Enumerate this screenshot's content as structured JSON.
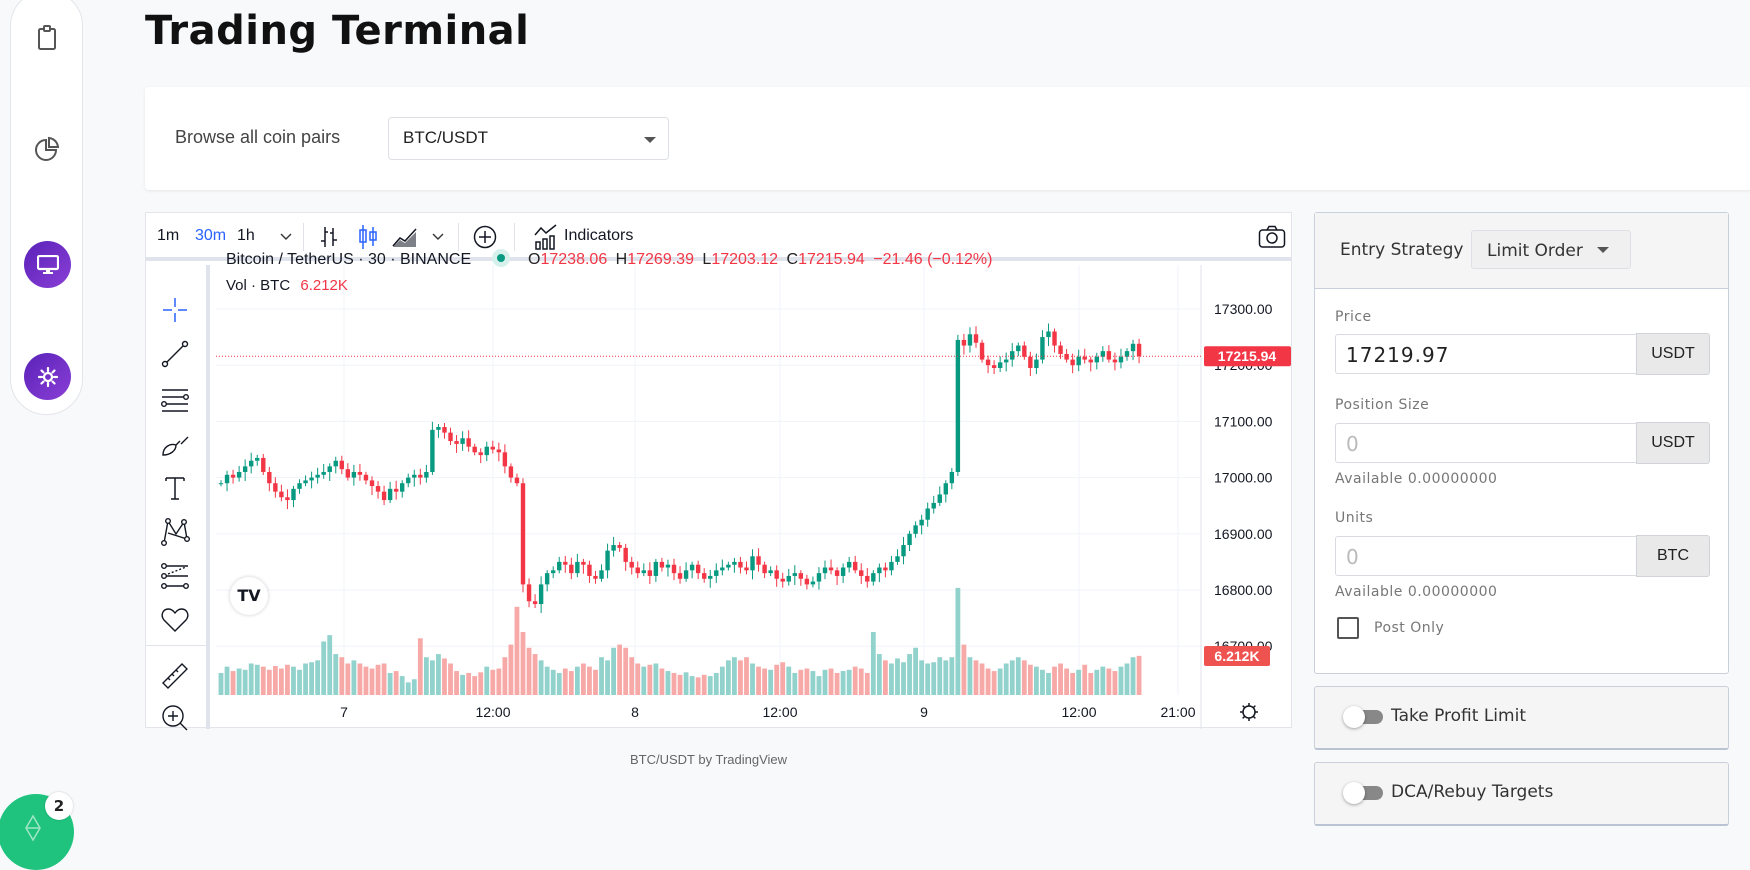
{
  "sidebar": {
    "items": [
      {
        "icon": "clipboard-icon"
      },
      {
        "icon": "pie-chart-icon"
      },
      {
        "icon": "monitor-icon",
        "active": true
      },
      {
        "icon": "gear-icon",
        "active": true
      }
    ],
    "notification": {
      "icon": "rocket-icon",
      "count": "2",
      "color": "#1fc37e"
    }
  },
  "header": {
    "title": "Trading Terminal"
  },
  "pair_selector": {
    "label": "Browse all coin pairs",
    "value": "BTC/USDT"
  },
  "chart_toolbar": {
    "intervals": [
      "1m",
      "30m",
      "1h"
    ],
    "active_interval": "30m",
    "indicators_label": "Indicators"
  },
  "chart_legend": {
    "symbol": "Bitcoin / TetherUS · 30 · BINANCE",
    "o_label": "O",
    "o": "17238.06",
    "h_label": "H",
    "h": "17269.39",
    "l_label": "L",
    "l": "17203.12",
    "c_label": "C",
    "c": "17215.94",
    "change": "−21.46 (−0.12%)",
    "vol_label": "Vol · BTC",
    "vol": "6.212K"
  },
  "chart_data": {
    "type": "candlestick",
    "interval": "30m",
    "yaxis_ticks": [
      "17300.00",
      "17200.00",
      "17100.00",
      "17000.00",
      "16900.00",
      "16800.00",
      "16700.00"
    ],
    "ylim": [
      16700,
      17300
    ],
    "xaxis_ticks": [
      "7",
      "12:00",
      "8",
      "12:00",
      "9",
      "12:00",
      "21:00"
    ],
    "last_price_label": "17215.94",
    "last_volume_label": "6.212K",
    "grid": true,
    "up_color": "#089981",
    "down_color": "#f23645",
    "closes": [
      16990,
      17005,
      17000,
      17010,
      17020,
      17030,
      17035,
      17010,
      16990,
      16975,
      16965,
      16960,
      16980,
      16990,
      16995,
      17000,
      17005,
      17010,
      17020,
      17030,
      17015,
      17000,
      17010,
      17005,
      16995,
      16985,
      16975,
      16960,
      16980,
      16975,
      16990,
      17000,
      17005,
      17000,
      17010,
      17085,
      17090,
      17080,
      17065,
      17060,
      17070,
      17055,
      17045,
      17040,
      17055,
      17050,
      17045,
      17020,
      17000,
      16990,
      16810,
      16780,
      16775,
      16810,
      16830,
      16835,
      16850,
      16845,
      16830,
      16850,
      16845,
      16825,
      16820,
      16835,
      16870,
      16880,
      16875,
      16850,
      16840,
      16830,
      16835,
      16825,
      16850,
      16840,
      16845,
      16830,
      16820,
      16835,
      16845,
      16830,
      16820,
      16825,
      16835,
      16840,
      16845,
      16850,
      16840,
      16835,
      16860,
      16845,
      16830,
      16835,
      16820,
      16815,
      16825,
      16830,
      16820,
      16810,
      16815,
      16830,
      16840,
      16835,
      16825,
      16840,
      16850,
      16835,
      16825,
      16815,
      16830,
      16840,
      16835,
      16850,
      16860,
      16880,
      16900,
      16915,
      16925,
      16945,
      16955,
      16970,
      16990,
      17010,
      17245,
      17235,
      17255,
      17240,
      17210,
      17200,
      17195,
      17205,
      17210,
      17225,
      17235,
      17215,
      17195,
      17210,
      17250,
      17260,
      17235,
      17220,
      17210,
      17200,
      17215,
      17210,
      17205,
      17215,
      17225,
      17210,
      17205,
      17215,
      17225,
      17238.06,
      17215.94
    ],
    "volumes_k": [
      3.5,
      4.5,
      3.8,
      4.2,
      4.0,
      5.0,
      4.8,
      4.5,
      4.0,
      4.6,
      4.2,
      4.8,
      4.5,
      4.0,
      5.0,
      5.2,
      5.5,
      8.5,
      9.5,
      6.5,
      6.0,
      5.0,
      5.5,
      5.0,
      4.5,
      4.2,
      4.8,
      5.0,
      3.5,
      3.8,
      3.0,
      2.0,
      2.5,
      9.0,
      6.0,
      5.5,
      6.5,
      5.8,
      5.0,
      3.8,
      3.2,
      3.5,
      3.0,
      3.6,
      4.5,
      4.0,
      4.2,
      6.0,
      8.0,
      14.0,
      10.0,
      7.5,
      6.5,
      5.5,
      4.5,
      4.0,
      3.5,
      4.2,
      3.8,
      4.5,
      5.0,
      4.5,
      4.0,
      6.0,
      5.5,
      7.5,
      8.0,
      7.5,
      6.0,
      5.0,
      4.5,
      4.8,
      5.0,
      4.2,
      3.8,
      3.5,
      3.2,
      3.6,
      3.0,
      2.8,
      3.2,
      3.0,
      3.5,
      4.5,
      5.5,
      6.0,
      5.5,
      6.0,
      5.0,
      4.5,
      4.2,
      4.0,
      4.8,
      5.2,
      4.5,
      3.5,
      4.0,
      4.2,
      3.8,
      3.0,
      4.0,
      4.2,
      3.5,
      3.8,
      4.0,
      4.5,
      4.2,
      3.5,
      10.0,
      6.5,
      5.5,
      5.0,
      5.8,
      5.2,
      6.5,
      7.5,
      5.5,
      5.0,
      5.2,
      6.0,
      5.5,
      6.0,
      17.0,
      8.0,
      6.0,
      5.5,
      5.0,
      4.2,
      3.8,
      4.2,
      5.0,
      5.5,
      6.0,
      5.5,
      4.8,
      4.5,
      4.0,
      3.5,
      4.5,
      5.0,
      4.2,
      3.5,
      4.0,
      4.8,
      3.5,
      4.0,
      4.5,
      4.2,
      3.8,
      4.5,
      5.0,
      6.0,
      6.212
    ]
  },
  "chart_footer": "BTC/USDT by TradingView",
  "order_form": {
    "entry_strategy_label": "Entry Strategy",
    "entry_strategy_value": "Limit Order",
    "price_label": "Price",
    "price_value": "17219.97",
    "price_unit": "USDT",
    "position_size_label": "Position Size",
    "position_size_placeholder": "0",
    "position_size_unit": "USDT",
    "position_available": "Available 0.00000000",
    "units_label": "Units",
    "units_placeholder": "0",
    "units_unit": "BTC",
    "units_available": "Available 0.00000000",
    "post_only_label": "Post Only",
    "post_only_checked": false
  },
  "toggles": {
    "take_profit_label": "Take Profit Limit",
    "take_profit_on": false,
    "dca_label": "DCA/Rebuy Targets",
    "dca_on": false
  }
}
